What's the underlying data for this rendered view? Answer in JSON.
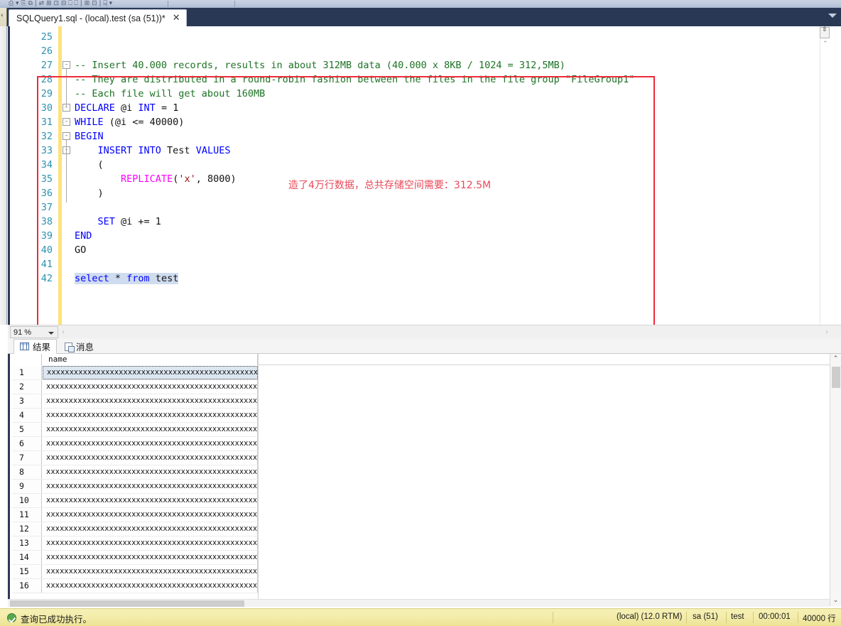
{
  "toolbar": {
    "glyph_row": "⎙  ▾ ⎘   ⧉ |  ⇄ ⊞ ⊡ ⊟  ⎕ ⎕ | ⊞  ⊡  | ⌸ ▾"
  },
  "tabstrip": {
    "left_chevron": "‹",
    "active_tab_title": "SQLQuery1.sql - (local).test (sa (51))*",
    "close_label": "✕",
    "dropdown_name": "tab-list-dropdown"
  },
  "editor": {
    "lines": [
      {
        "no": "25",
        "fold": "",
        "segments": []
      },
      {
        "no": "26",
        "fold": "",
        "segments": []
      },
      {
        "no": "27",
        "fold": "-",
        "segments": [
          {
            "t": "-- Insert 40.000 records, results in about 312MB data (40.000 x 8KB / 1024 = 312,5MB)",
            "c": "tok-comment"
          }
        ]
      },
      {
        "no": "28",
        "fold": "",
        "segments": [
          {
            "t": "-- They are distributed in a round-robin fashion between the files in the file group \"FileGroup1\"",
            "c": "tok-comment"
          }
        ]
      },
      {
        "no": "29",
        "fold": "",
        "segments": [
          {
            "t": "-- Each file will get about 160MB",
            "c": "tok-comment"
          }
        ]
      },
      {
        "no": "30",
        "fold": "-",
        "segments": [
          {
            "t": "DECLARE",
            "c": "tok-kw"
          },
          {
            "t": " @i ",
            "c": "tok-plain"
          },
          {
            "t": "INT",
            "c": "tok-kw"
          },
          {
            "t": " = 1",
            "c": "tok-plain"
          }
        ]
      },
      {
        "no": "31",
        "fold": "-",
        "segments": [
          {
            "t": "WHILE",
            "c": "tok-kw"
          },
          {
            "t": " (@i <= 40000)",
            "c": "tok-plain"
          }
        ]
      },
      {
        "no": "32",
        "fold": "-",
        "segments": [
          {
            "t": "BEGIN",
            "c": "tok-kw"
          }
        ]
      },
      {
        "no": "33",
        "fold": "-",
        "segments": [
          {
            "t": "    ",
            "c": "tok-plain"
          },
          {
            "t": "INSERT INTO",
            "c": "tok-kw"
          },
          {
            "t": " Test ",
            "c": "tok-plain"
          },
          {
            "t": "VALUES",
            "c": "tok-kw"
          }
        ]
      },
      {
        "no": "34",
        "fold": "",
        "segments": [
          {
            "t": "    (",
            "c": "tok-plain"
          }
        ]
      },
      {
        "no": "35",
        "fold": "",
        "segments": [
          {
            "t": "        ",
            "c": "tok-plain"
          },
          {
            "t": "REPLICATE",
            "c": "tok-fn"
          },
          {
            "t": "(",
            "c": "tok-plain"
          },
          {
            "t": "'x'",
            "c": "tok-str"
          },
          {
            "t": ", 8000)",
            "c": "tok-plain"
          }
        ]
      },
      {
        "no": "36",
        "fold": "",
        "segments": [
          {
            "t": "    )",
            "c": "tok-plain"
          }
        ]
      },
      {
        "no": "37",
        "fold": "",
        "segments": []
      },
      {
        "no": "38",
        "fold": "",
        "segments": [
          {
            "t": "    ",
            "c": "tok-plain"
          },
          {
            "t": "SET",
            "c": "tok-kw"
          },
          {
            "t": " @i += 1",
            "c": "tok-plain"
          }
        ]
      },
      {
        "no": "39",
        "fold": "",
        "segments": [
          {
            "t": "END",
            "c": "tok-kw"
          }
        ]
      },
      {
        "no": "40",
        "fold": "",
        "segments": [
          {
            "t": "GO",
            "c": "tok-plain"
          }
        ]
      },
      {
        "no": "41",
        "fold": "",
        "segments": []
      },
      {
        "no": "42",
        "fold": "",
        "segments": [
          {
            "t": "select",
            "c": "tok-kw sel"
          },
          {
            "t": " * ",
            "c": "tok-plain sel"
          },
          {
            "t": "from",
            "c": "tok-kw sel"
          },
          {
            "t": " test",
            "c": "tok-plain sel"
          }
        ]
      }
    ],
    "annotation_text": "造了4万行数据，总共存储空间需要：312.5M",
    "annotation_color": "#e8495a",
    "annotation_box_color": "#ee2b3a",
    "splitter_glyph": "⇳",
    "scroll_up_glyph": "⌃"
  },
  "zoombar": {
    "zoom_level": "91 %",
    "hscroll_left_glyph": "‹",
    "hscroll_right_glyph": "›"
  },
  "result_tabs": [
    {
      "label": "结果",
      "icon": "grid-icon",
      "active": true
    },
    {
      "label": "消息",
      "icon": "message-icon",
      "active": false
    }
  ],
  "results_grid": {
    "columns": [
      "name"
    ],
    "selected_row": 1,
    "cell_value": "xxxxxxxxxxxxxxxxxxxxxxxxxxxxxxxxxxxxxxxxxxxxxxxxxxxxxxxxxxx...",
    "rows": [
      {
        "n": "1",
        "name": "xxxxxxxxxxxxxxxxxxxxxxxxxxxxxxxxxxxxxxxxxxxxxxxxxxxxxxxxxxx..."
      },
      {
        "n": "2",
        "name": "xxxxxxxxxxxxxxxxxxxxxxxxxxxxxxxxxxxxxxxxxxxxxxxxxxxxxxxxxxx..."
      },
      {
        "n": "3",
        "name": "xxxxxxxxxxxxxxxxxxxxxxxxxxxxxxxxxxxxxxxxxxxxxxxxxxxxxxxxxxx..."
      },
      {
        "n": "4",
        "name": "xxxxxxxxxxxxxxxxxxxxxxxxxxxxxxxxxxxxxxxxxxxxxxxxxxxxxxxxxxx..."
      },
      {
        "n": "5",
        "name": "xxxxxxxxxxxxxxxxxxxxxxxxxxxxxxxxxxxxxxxxxxxxxxxxxxxxxxxxxxx..."
      },
      {
        "n": "6",
        "name": "xxxxxxxxxxxxxxxxxxxxxxxxxxxxxxxxxxxxxxxxxxxxxxxxxxxxxxxxxxx..."
      },
      {
        "n": "7",
        "name": "xxxxxxxxxxxxxxxxxxxxxxxxxxxxxxxxxxxxxxxxxxxxxxxxxxxxxxxxxxx..."
      },
      {
        "n": "8",
        "name": "xxxxxxxxxxxxxxxxxxxxxxxxxxxxxxxxxxxxxxxxxxxxxxxxxxxxxxxxxxx..."
      },
      {
        "n": "9",
        "name": "xxxxxxxxxxxxxxxxxxxxxxxxxxxxxxxxxxxxxxxxxxxxxxxxxxxxxxxxxxx..."
      },
      {
        "n": "10",
        "name": "xxxxxxxxxxxxxxxxxxxxxxxxxxxxxxxxxxxxxxxxxxxxxxxxxxxxxxxxxxx..."
      },
      {
        "n": "11",
        "name": "xxxxxxxxxxxxxxxxxxxxxxxxxxxxxxxxxxxxxxxxxxxxxxxxxxxxxxxxxxx..."
      },
      {
        "n": "12",
        "name": "xxxxxxxxxxxxxxxxxxxxxxxxxxxxxxxxxxxxxxxxxxxxxxxxxxxxxxxxxxx..."
      },
      {
        "n": "13",
        "name": "xxxxxxxxxxxxxxxxxxxxxxxxxxxxxxxxxxxxxxxxxxxxxxxxxxxxxxxxxxx..."
      },
      {
        "n": "14",
        "name": "xxxxxxxxxxxxxxxxxxxxxxxxxxxxxxxxxxxxxxxxxxxxxxxxxxxxxxxxxxx..."
      },
      {
        "n": "15",
        "name": "xxxxxxxxxxxxxxxxxxxxxxxxxxxxxxxxxxxxxxxxxxxxxxxxxxxxxxxxxxx..."
      },
      {
        "n": "16",
        "name": "xxxxxxxxxxxxxxxxxxxxxxxxxxxxxxxxxxxxxxxxxxxxxxxxxxxxxxxxxxx..."
      }
    ],
    "scroll_up_glyph": "⌃",
    "scroll_down_glyph": "⌄"
  },
  "statusbar": {
    "message": "查询已成功执行。",
    "server": "(local) (12.0 RTM)",
    "login": "sa (51)",
    "database": "test",
    "elapsed": "00:00:01",
    "rowcount": "40000 行",
    "ok_icon": "success-check-icon"
  }
}
